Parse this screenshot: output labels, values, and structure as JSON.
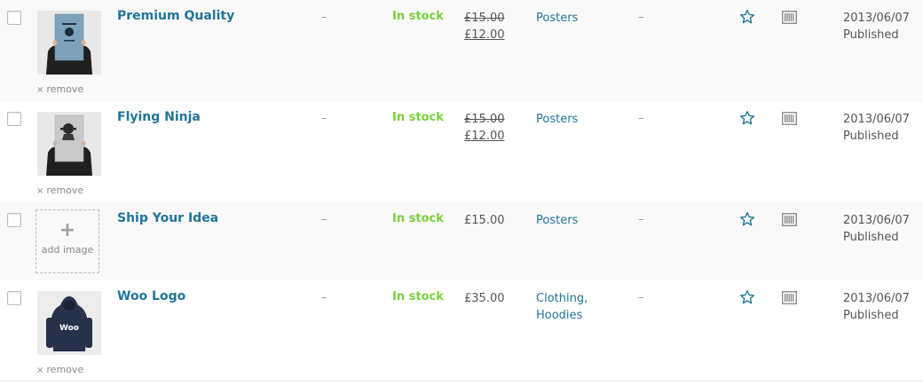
{
  "colors": {
    "link": "#21759b",
    "in_stock": "#7ad03a",
    "row_alt_bg": "#f9f9f9"
  },
  "labels": {
    "remove": "remove",
    "remove_icon": "×",
    "add_image": "add image",
    "add_icon": "+"
  },
  "products": [
    {
      "name": "Premium Quality",
      "sku": "–",
      "stock": "In stock",
      "price_regular": "£15.00",
      "price_sale": "£12.00",
      "categories": [
        "Posters"
      ],
      "tags": "–",
      "featured_icon": "star-outline-icon",
      "type_icon": "product-type-icon",
      "date": "2013/06/07",
      "status": "Published",
      "thumbnail": "poster-premium-quality"
    },
    {
      "name": "Flying Ninja",
      "sku": "–",
      "stock": "In stock",
      "price_regular": "£15.00",
      "price_sale": "£12.00",
      "categories": [
        "Posters"
      ],
      "tags": "–",
      "featured_icon": "star-outline-icon",
      "type_icon": "product-type-icon",
      "date": "2013/06/07",
      "status": "Published",
      "thumbnail": "poster-flying-ninja"
    },
    {
      "name": "Ship Your Idea",
      "sku": "–",
      "stock": "In stock",
      "price": "£15.00",
      "categories": [
        "Posters"
      ],
      "tags": "–",
      "featured_icon": "star-outline-icon",
      "type_icon": "product-type-icon",
      "date": "2013/06/07",
      "status": "Published",
      "thumbnail": null
    },
    {
      "name": "Woo Logo",
      "sku": "–",
      "stock": "In stock",
      "price": "£35.00",
      "categories": [
        "Clothing,",
        "Hoodies"
      ],
      "tags": "–",
      "featured_icon": "star-outline-icon",
      "type_icon": "product-type-icon",
      "date": "2013/06/07",
      "status": "Published",
      "thumbnail": "hoodie-woo-logo",
      "thumbnail_text": "Woo"
    }
  ]
}
